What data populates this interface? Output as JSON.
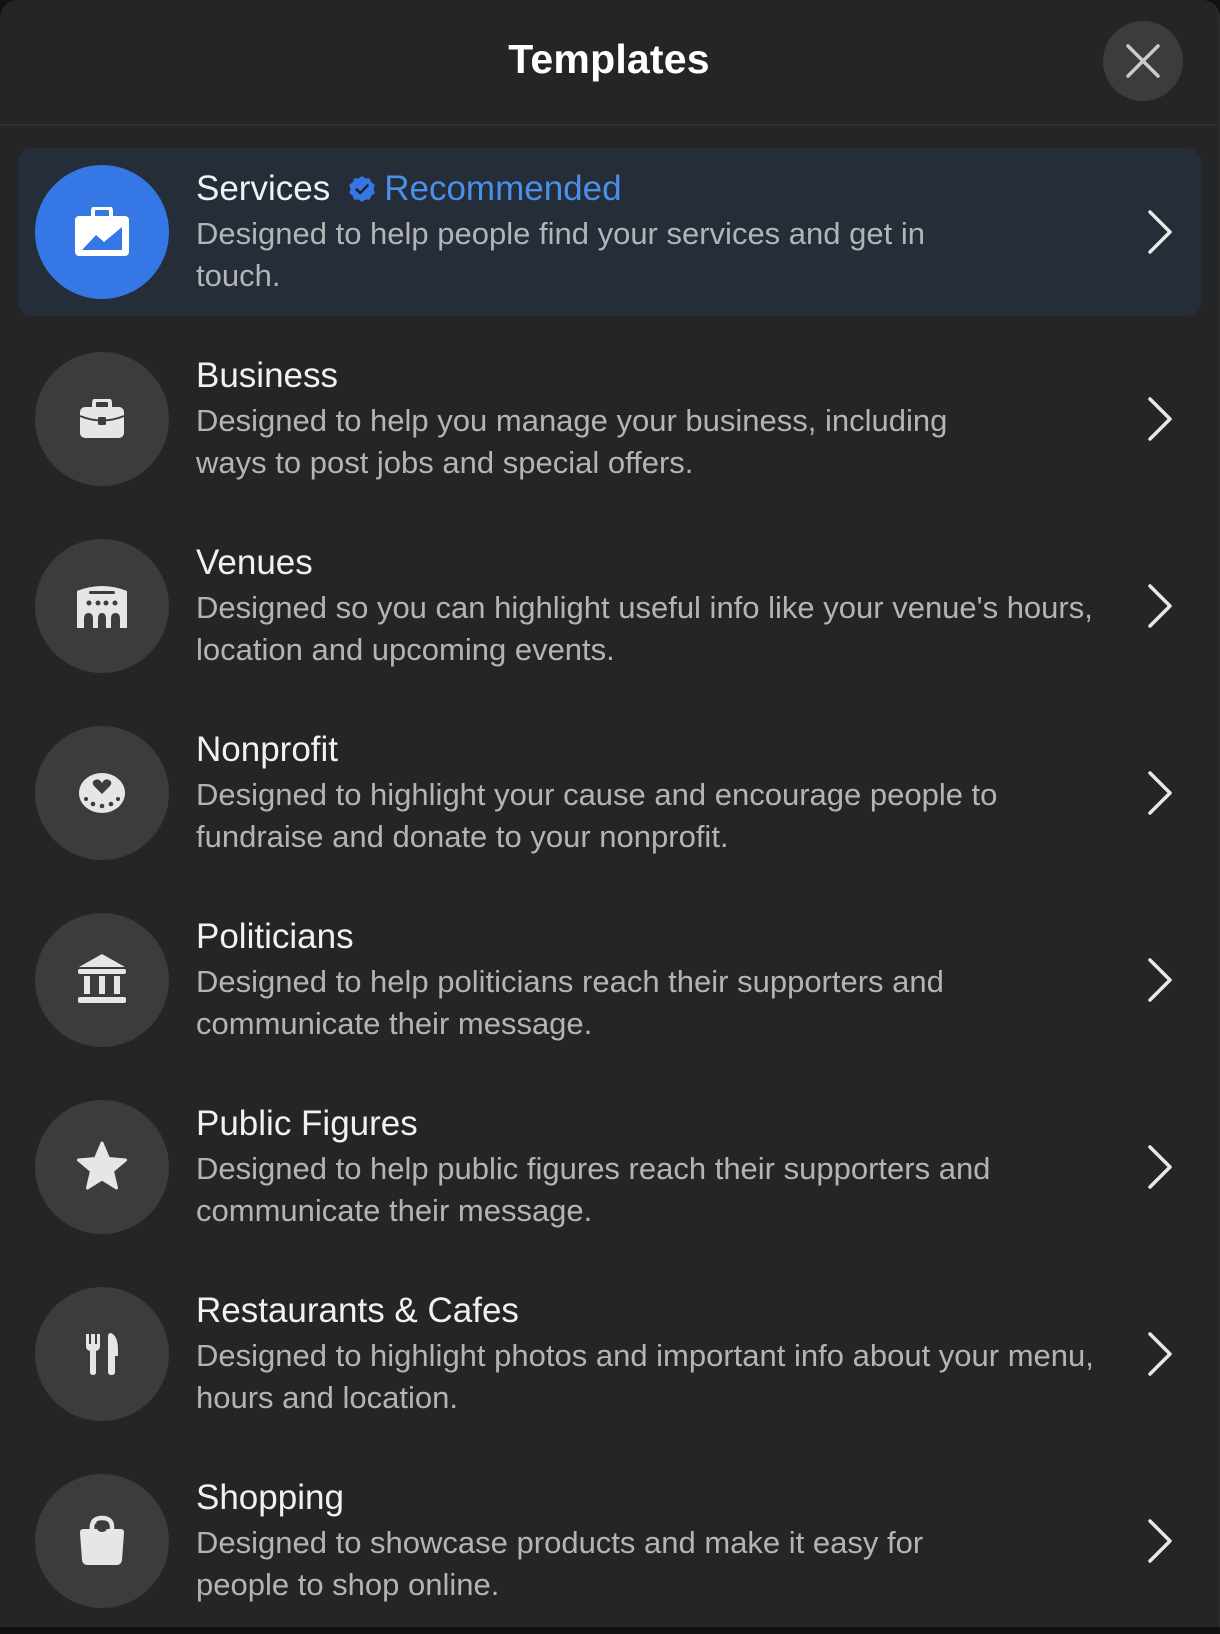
{
  "header": {
    "title": "Templates",
    "close_icon": "close-icon"
  },
  "colors": {
    "accent": "#3578e5",
    "recommended_text": "#4a90e8",
    "highlight_row": "#252d38",
    "panel_bg": "#232526",
    "icon_circle": "#3a3c3d"
  },
  "templates": [
    {
      "title": "Services",
      "badge": "Recommended",
      "badge_icon": "verified-badge-icon",
      "description": "Designed to help people find your services and get in touch.",
      "icon": "briefcase-chart-icon",
      "highlighted": true
    },
    {
      "title": "Business",
      "description": "Designed to help you manage your business, including ways to post jobs and special offers.",
      "icon": "briefcase-icon"
    },
    {
      "title": "Venues",
      "description": "Designed so you can highlight useful info like your venue's hours, location and upcoming events.",
      "icon": "venue-building-icon"
    },
    {
      "title": "Nonprofit",
      "description": "Designed to highlight your cause and encourage people to fundraise and donate to your nonprofit.",
      "icon": "heart-donation-icon"
    },
    {
      "title": "Politicians",
      "description": "Designed to help politicians reach their supporters and communicate their message.",
      "icon": "government-building-icon"
    },
    {
      "title": "Public Figures",
      "description": "Designed to help public figures reach their supporters and communicate their message.",
      "icon": "star-icon"
    },
    {
      "title": "Restaurants & Cafes",
      "description": "Designed to highlight photos and important info about your menu, hours and location.",
      "icon": "fork-knife-icon"
    },
    {
      "title": "Shopping",
      "description": "Designed to showcase products and make it easy for people to shop online.",
      "icon": "shopping-bag-icon"
    }
  ]
}
